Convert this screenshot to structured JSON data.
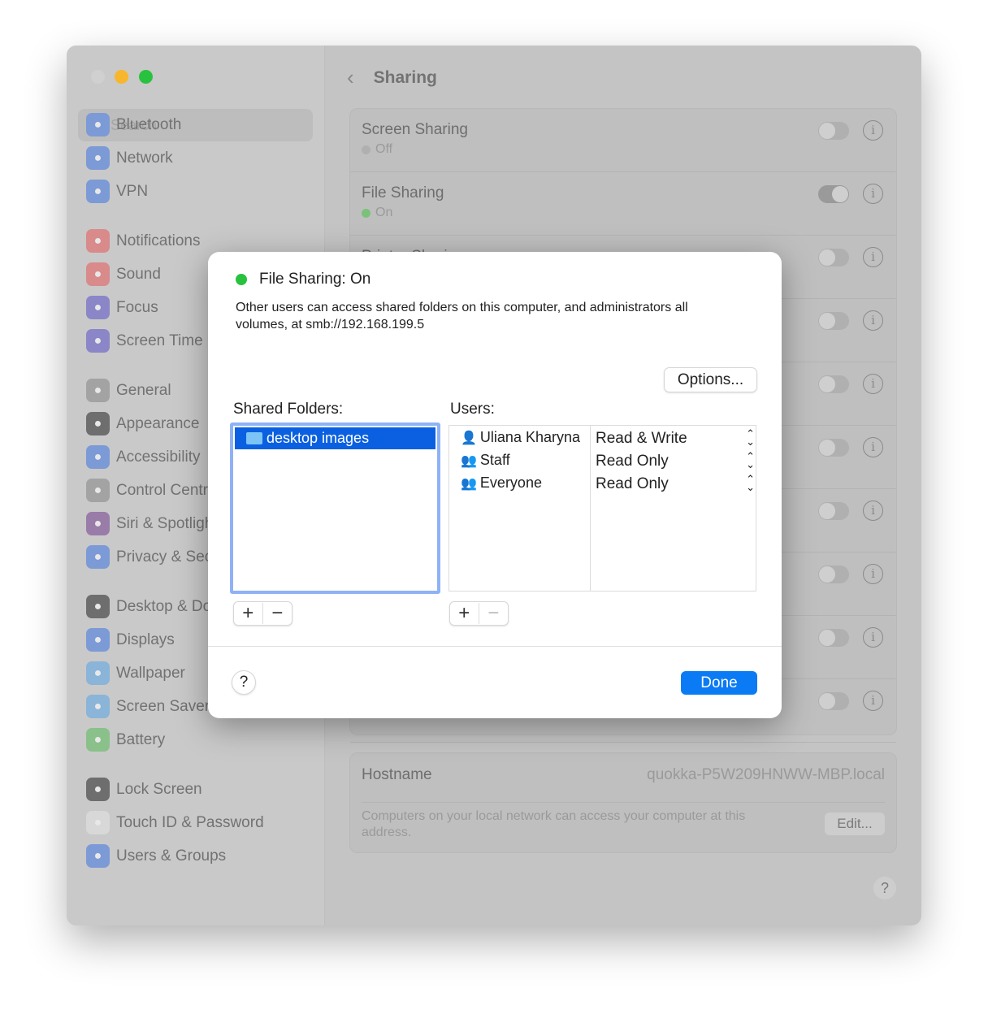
{
  "window": {
    "colors": {
      "close": "#d0d0d0",
      "minimize": "#f8b62c",
      "zoom": "#29c23f"
    }
  },
  "sidebar": {
    "search_placeholder": "Search",
    "items": [
      {
        "label": "Bluetooth",
        "icon": "bluetooth-icon",
        "color": "#7c9ad6"
      },
      {
        "label": "Network",
        "icon": "globe-icon",
        "color": "#7c9ad6"
      },
      {
        "label": "VPN",
        "icon": "vpn-icon",
        "color": "#7c9ad6"
      },
      {
        "label": "Notifications",
        "icon": "bell-icon",
        "color": "#d98a8a"
      },
      {
        "label": "Sound",
        "icon": "speaker-icon",
        "color": "#d98a8a"
      },
      {
        "label": "Focus",
        "icon": "moon-icon",
        "color": "#8a86c8"
      },
      {
        "label": "Screen Time",
        "icon": "hourglass-icon",
        "color": "#8a86c8"
      },
      {
        "label": "General",
        "icon": "gear-icon",
        "color": "#a3a3a3"
      },
      {
        "label": "Appearance",
        "icon": "appearance-icon",
        "color": "#6e6e6e"
      },
      {
        "label": "Accessibility",
        "icon": "accessibility-icon",
        "color": "#7c9ad6"
      },
      {
        "label": "Control Centre",
        "icon": "switches-icon",
        "color": "#a3a3a3"
      },
      {
        "label": "Siri & Spotlight",
        "icon": "siri-icon",
        "color": "#9a7ca8"
      },
      {
        "label": "Privacy & Security",
        "icon": "hand-icon",
        "color": "#7c9ad6"
      },
      {
        "label": "Desktop & Dock",
        "icon": "dock-icon",
        "color": "#6e6e6e"
      },
      {
        "label": "Displays",
        "icon": "sun-icon",
        "color": "#7c9ad6"
      },
      {
        "label": "Wallpaper",
        "icon": "flower-icon",
        "color": "#8ab4d8"
      },
      {
        "label": "Screen Saver",
        "icon": "screensaver-icon",
        "color": "#8ab4d8"
      },
      {
        "label": "Battery",
        "icon": "battery-icon",
        "color": "#8ac08a"
      },
      {
        "label": "Lock Screen",
        "icon": "lock-icon",
        "color": "#6e6e6e"
      },
      {
        "label": "Touch ID & Password",
        "icon": "fingerprint-icon",
        "color": "#d8d8d8"
      },
      {
        "label": "Users & Groups",
        "icon": "users-icon",
        "color": "#7c9ad6"
      }
    ]
  },
  "header": {
    "title": "Sharing"
  },
  "services": [
    {
      "title": "Screen Sharing",
      "status": "Off",
      "on": false
    },
    {
      "title": "File Sharing",
      "status": "On",
      "on": true
    },
    {
      "title": "Printer Sharing",
      "status": "",
      "on": false
    }
  ],
  "hostname": {
    "label": "Hostname",
    "value": "quokka-P5W209HNWW-MBP.local",
    "description": "Computers on your local network can access your computer at this address.",
    "edit": "Edit..."
  },
  "help": "?",
  "dialog": {
    "title": "File Sharing: On",
    "description": "Other users can access shared folders on this computer, and administrators all volumes, at smb://192.168.199.5",
    "options": "Options...",
    "shared_folders_label": "Shared Folders:",
    "folders": [
      "desktop images"
    ],
    "users_label": "Users:",
    "users": [
      {
        "name": "Uliana Kharyna",
        "permission": "Read & Write"
      },
      {
        "name": "Staff",
        "permission": "Read Only"
      },
      {
        "name": "Everyone",
        "permission": "Read Only"
      }
    ],
    "plus": "+",
    "minus": "−",
    "help": "?",
    "done": "Done"
  }
}
